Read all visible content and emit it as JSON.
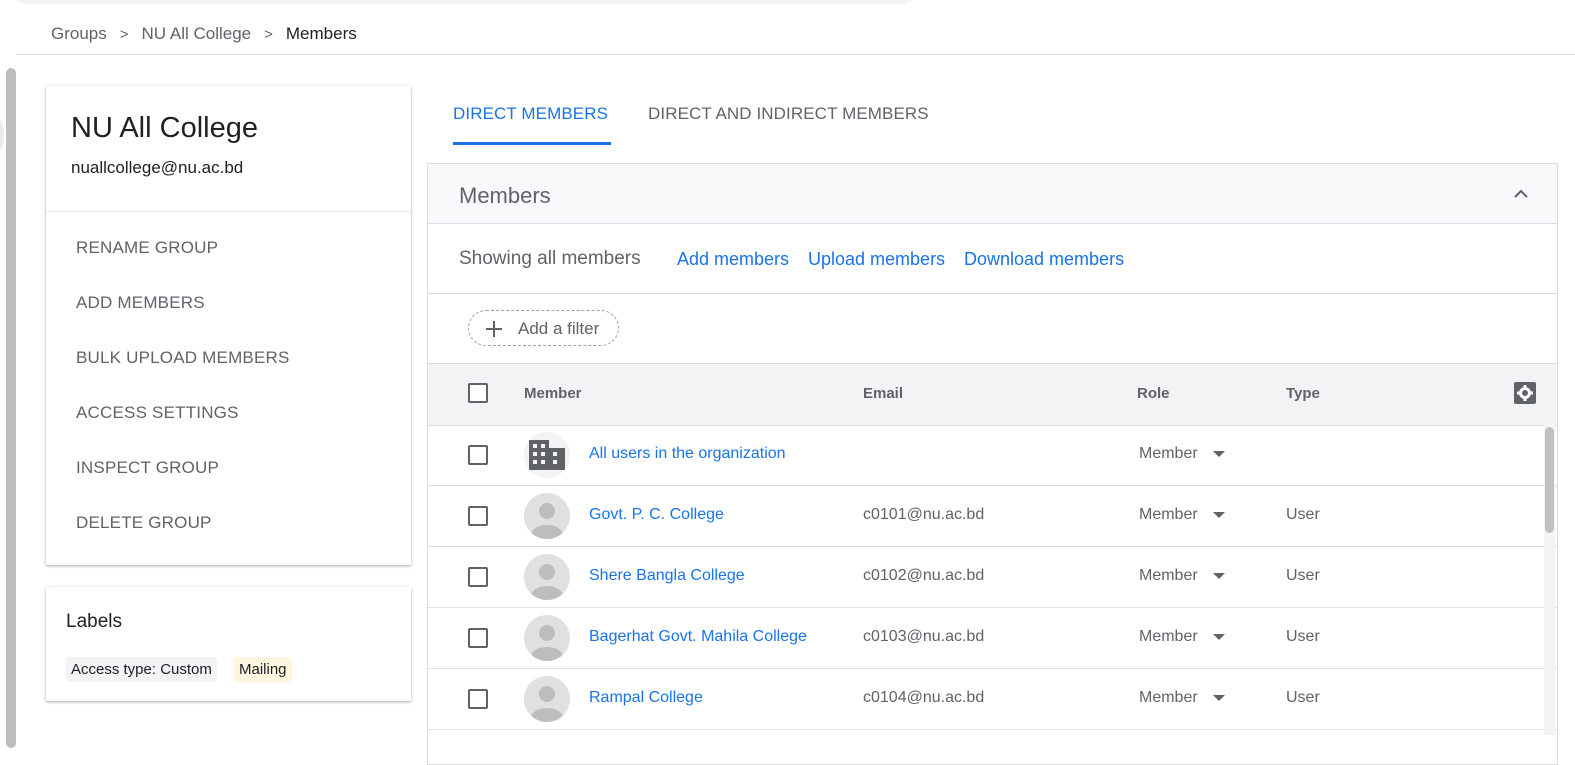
{
  "breadcrumb": {
    "items": [
      "Groups",
      "NU All College"
    ],
    "current": "Members",
    "separator": ">"
  },
  "group": {
    "name": "NU All College",
    "email": "nuallcollege@nu.ac.bd",
    "actions": [
      "RENAME GROUP",
      "ADD MEMBERS",
      "BULK UPLOAD MEMBERS",
      "ACCESS SETTINGS",
      "INSPECT GROUP",
      "DELETE GROUP"
    ]
  },
  "labels": {
    "title": "Labels",
    "chips": [
      "Access type: Custom",
      "Mailing"
    ]
  },
  "tabs": [
    {
      "label": "DIRECT MEMBERS",
      "active": true
    },
    {
      "label": "DIRECT AND INDIRECT MEMBERS",
      "active": false
    }
  ],
  "members_panel": {
    "title": "Members",
    "showing": "Showing all members",
    "links": [
      "Add members",
      "Upload members",
      "Download members"
    ],
    "filter_label": "Add a filter"
  },
  "table": {
    "columns": [
      "Member",
      "Email",
      "Role",
      "Type"
    ],
    "rows": [
      {
        "name": "All users in the organization",
        "email": "",
        "role": "Member",
        "type": "",
        "avatar": "building-icon"
      },
      {
        "name": "Govt. P. C. College",
        "email": "c0101@nu.ac.bd",
        "role": "Member",
        "type": "User",
        "avatar": "person-icon"
      },
      {
        "name": "Shere Bangla College",
        "email": "c0102@nu.ac.bd",
        "role": "Member",
        "type": "User",
        "avatar": "person-icon"
      },
      {
        "name": "Bagerhat Govt. Mahila College",
        "email": "c0103@nu.ac.bd",
        "role": "Member",
        "type": "User",
        "avatar": "person-icon"
      },
      {
        "name": "Rampal College",
        "email": "c0104@nu.ac.bd",
        "role": "Member",
        "type": "User",
        "avatar": "person-icon"
      }
    ]
  },
  "colors": {
    "accent": "#1a73e8",
    "text_secondary": "#5f6368",
    "mailing_chip": "#fef7e0",
    "access_chip": "#f1f3f4"
  }
}
